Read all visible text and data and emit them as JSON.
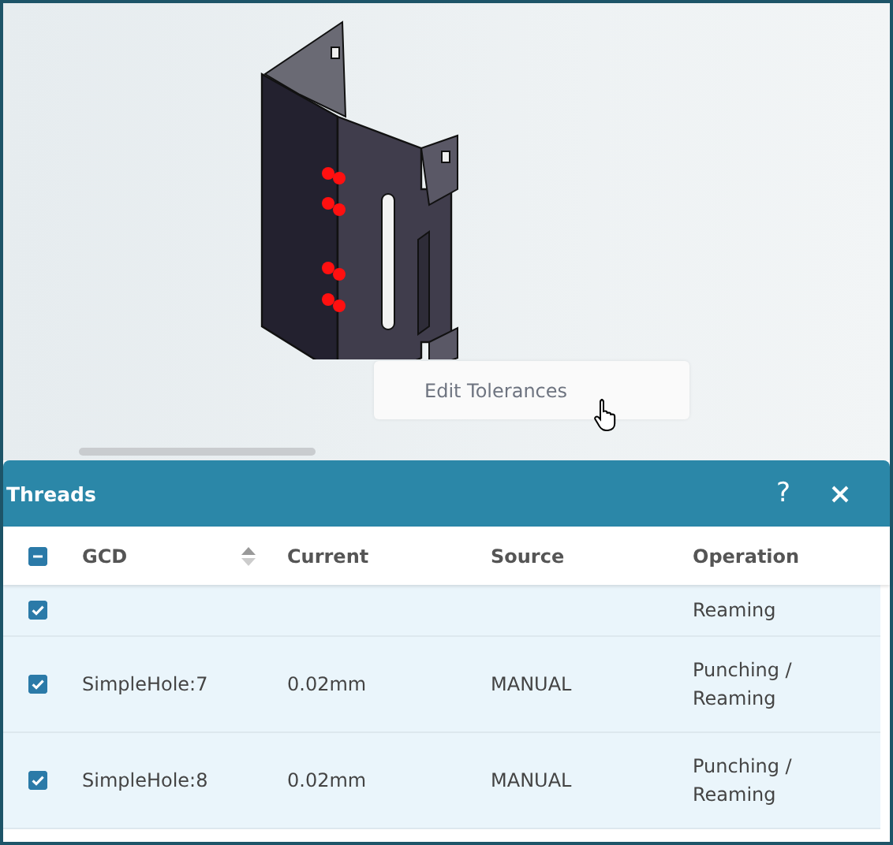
{
  "viewport": {
    "context_menu": {
      "items": [
        "Edit Tolerances"
      ]
    }
  },
  "panel": {
    "title": "Threads",
    "help": "?",
    "table": {
      "select_all": {
        "indeterminate": true
      },
      "columns": [
        {
          "label": "GCD",
          "sortable": true
        },
        {
          "label": "Current",
          "sortable": false
        },
        {
          "label": "Source",
          "sortable": false
        },
        {
          "label": "Operation",
          "sortable": false
        }
      ],
      "rows": [
        {
          "checked": true,
          "cells": [
            null,
            null,
            null,
            "Reaming"
          ]
        },
        {
          "checked": true,
          "cells": [
            "SimpleHole:7",
            "0.02mm",
            "MANUAL",
            "Punching / Reaming"
          ]
        },
        {
          "checked": true,
          "cells": [
            "SimpleHole:8",
            "0.02mm",
            "MANUAL",
            "Punching / Reaming"
          ]
        }
      ]
    }
  }
}
